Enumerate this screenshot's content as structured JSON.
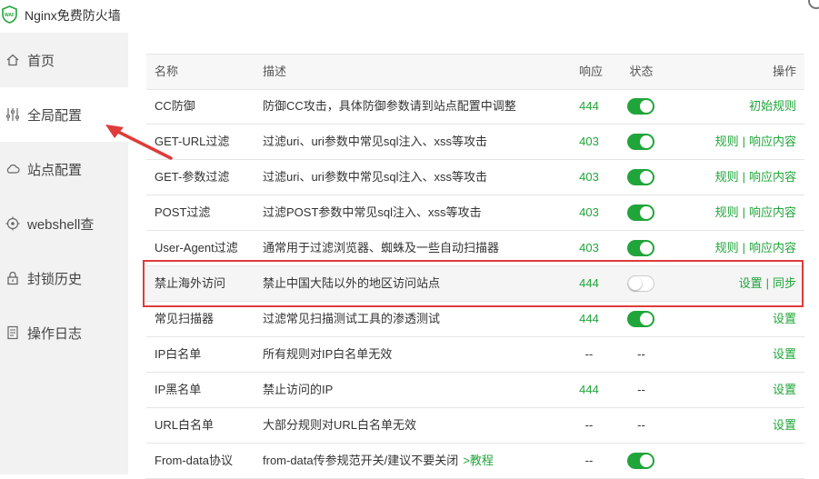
{
  "app": {
    "title": "Nginx免费防火墙"
  },
  "sidebar": {
    "items": [
      {
        "label": "首页",
        "icon": "home-icon"
      },
      {
        "label": "全局配置",
        "icon": "sliders-icon"
      },
      {
        "label": "站点配置",
        "icon": "cloud-icon"
      },
      {
        "label": "webshell查",
        "icon": "target-icon"
      },
      {
        "label": "封锁历史",
        "icon": "lock-icon"
      },
      {
        "label": "操作日志",
        "icon": "document-icon"
      }
    ],
    "active_index": 1
  },
  "table": {
    "headers": {
      "name": "名称",
      "desc": "描述",
      "resp": "响应",
      "state": "状态",
      "ops": "操作"
    },
    "rows": [
      {
        "name": "CC防御",
        "desc": "防御CC攻击，具体防御参数请到站点配置中调整",
        "resp": "444",
        "state": "on",
        "ops": [
          "初始规则"
        ]
      },
      {
        "name": "GET-URL过滤",
        "desc": "过滤uri、uri参数中常见sql注入、xss等攻击",
        "resp": "403",
        "state": "on",
        "ops": [
          "规则",
          "响应内容"
        ]
      },
      {
        "name": "GET-参数过滤",
        "desc": "过滤uri、uri参数中常见sql注入、xss等攻击",
        "resp": "403",
        "state": "on",
        "ops": [
          "规则",
          "响应内容"
        ]
      },
      {
        "name": "POST过滤",
        "desc": "过滤POST参数中常见sql注入、xss等攻击",
        "resp": "403",
        "state": "on",
        "ops": [
          "规则",
          "响应内容"
        ]
      },
      {
        "name": "User-Agent过滤",
        "desc": "通常用于过滤浏览器、蜘蛛及一些自动扫描器",
        "resp": "403",
        "state": "on",
        "ops": [
          "规则",
          "响应内容"
        ]
      },
      {
        "name": "禁止海外访问",
        "desc": "禁止中国大陆以外的地区访问站点",
        "resp": "444",
        "state": "off",
        "ops": [
          "设置",
          "同步"
        ]
      },
      {
        "name": "常见扫描器",
        "desc": "过滤常见扫描测试工具的渗透测试",
        "resp": "444",
        "state": "on",
        "ops": [
          "设置"
        ]
      },
      {
        "name": "IP白名单",
        "desc": "所有规则对IP白名单无效",
        "resp": "--",
        "state": "--",
        "ops": [
          "设置"
        ]
      },
      {
        "name": "IP黑名单",
        "desc": "禁止访问的IP",
        "resp": "444",
        "state": "--",
        "ops": [
          "设置"
        ]
      },
      {
        "name": "URL白名单",
        "desc": "大部分规则对URL白名单无效",
        "resp": "--",
        "state": "--",
        "ops": [
          "设置"
        ]
      },
      {
        "name": "From-data协议",
        "desc": "from-data传参规范开关/建议不要关闭",
        "desc_link": ">教程",
        "resp": "--",
        "state": "on",
        "ops": []
      }
    ]
  },
  "colors": {
    "accent": "#20a53a",
    "highlight": "#e03b3b"
  }
}
